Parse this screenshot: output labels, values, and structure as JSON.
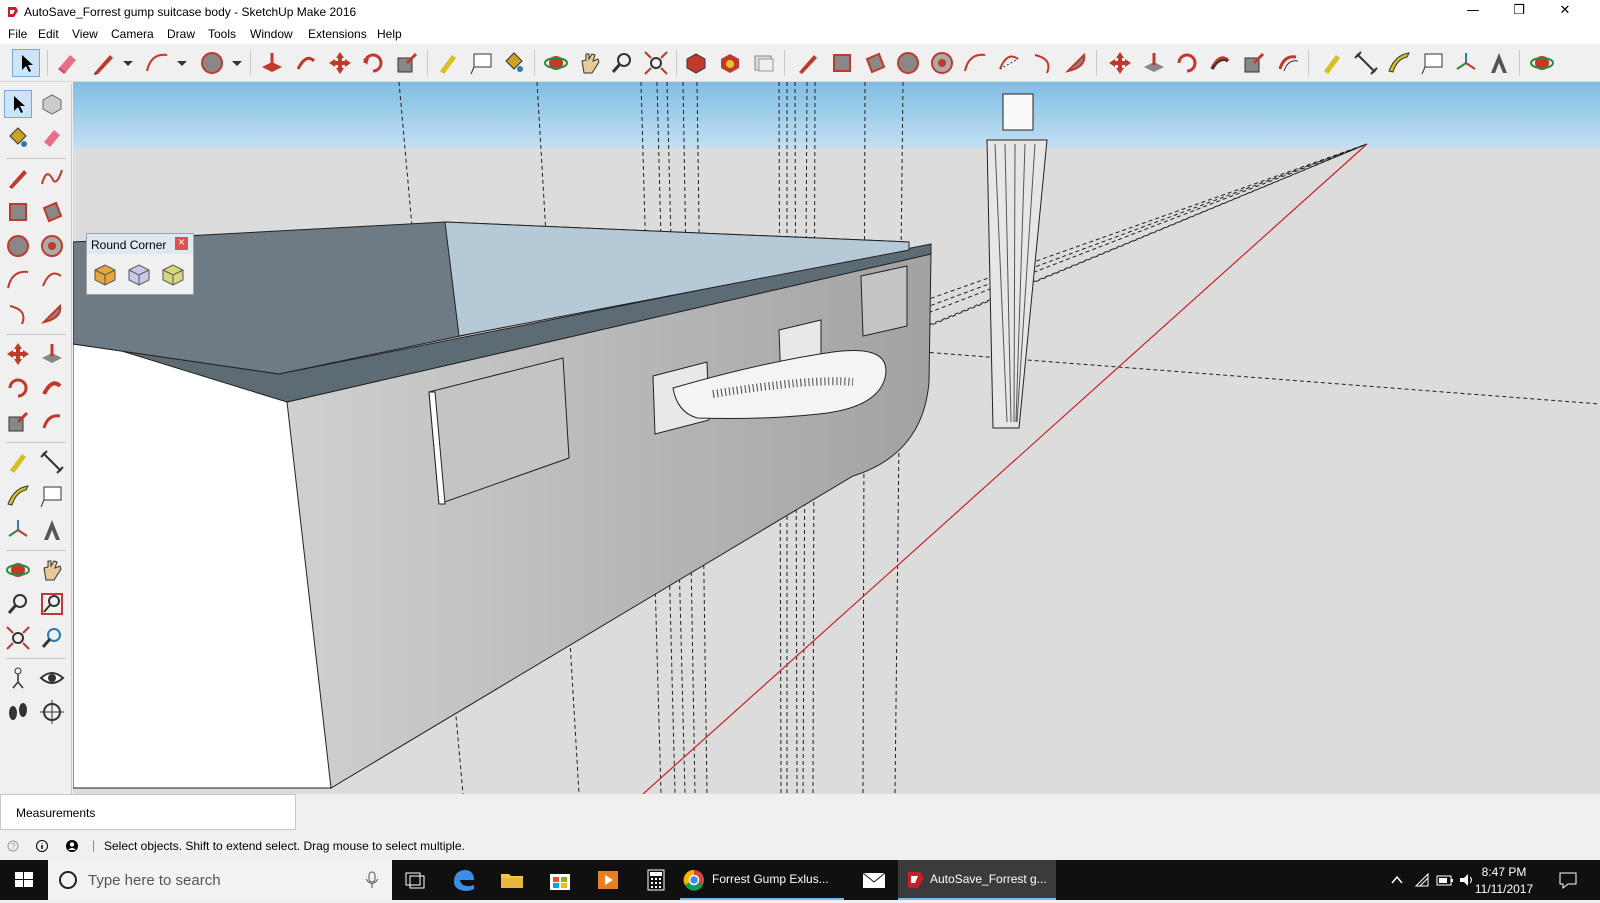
{
  "window": {
    "title": "AutoSave_Forrest gump suitcase body - SketchUp Make 2016",
    "minimize": "—",
    "restore": "❐",
    "close": "✕"
  },
  "menu": [
    "File",
    "Edit",
    "View",
    "Camera",
    "Draw",
    "Tools",
    "Window",
    "Extensions",
    "Help"
  ],
  "round_corner": {
    "title": "Round Corner",
    "close": "×"
  },
  "measurements": {
    "label": "Measurements",
    "value": ""
  },
  "status": {
    "text": "Select objects. Shift to extend select. Drag mouse to select multiple."
  },
  "taskbar": {
    "search_placeholder": "Type here to search",
    "apps": [
      {
        "label": "Forrest Gump Exlus..."
      },
      {
        "label": "AutoSave_Forrest g..."
      }
    ],
    "time": "8:47 PM",
    "date": "11/11/2017"
  },
  "colors": {
    "sky": "#9ccbe9",
    "ground": "#dcdcdc",
    "red_axis": "#cc2222",
    "accent": "#cce4f7",
    "taskbar": "#101010"
  }
}
